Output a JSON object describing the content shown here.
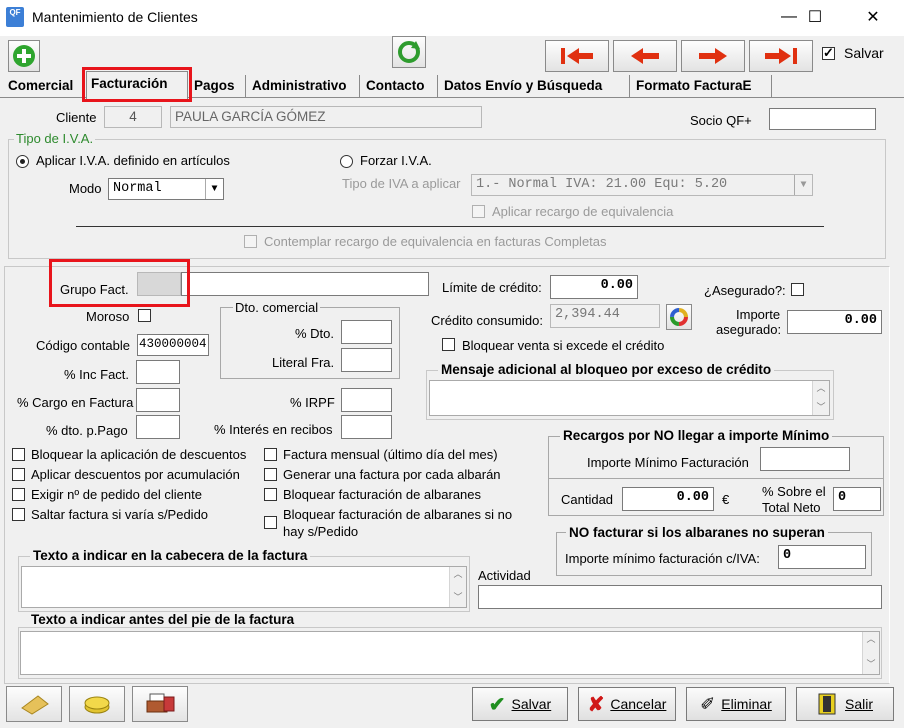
{
  "window": {
    "title": "Mantenimiento de Clientes",
    "app_icon": "QF"
  },
  "toolbar": {
    "save_label": "Salvar"
  },
  "tabs": [
    "Comercial",
    "Facturación",
    "Pagos",
    "Administrativo",
    "Contacto",
    "Datos Envío y Búsqueda",
    "Formato FacturaE"
  ],
  "client": {
    "label": "Cliente",
    "id": "4",
    "name": "PAULA GARCÍA GÓMEZ",
    "socio_label": "Socio QF+",
    "socio_value": ""
  },
  "iva": {
    "group_title": "Tipo de I.V.A.",
    "apply_label": "Aplicar I.V.A. definido en artículos",
    "modo_label": "Modo",
    "modo_value": "Normal",
    "force_label": "Forzar I.V.A.",
    "tipo_label": "Tipo de IVA a aplicar",
    "tipo_value": "1.- Normal  IVA: 21.00  Equ: 5.20",
    "recargo_label": "Aplicar recargo de equivalencia",
    "contemplar_label": "Contemplar recargo de equivalencia en facturas Completas"
  },
  "fact": {
    "grupo_label": "Grupo Fact.",
    "moroso_label": "Moroso",
    "codigo_label": "Código contable",
    "codigo_value": "430000004",
    "inc_label": "% Inc Fact.",
    "cargo_label": "% Cargo en Factura",
    "dto_pago_label": "% dto. p.Pago",
    "dto_group": "Dto. comercial",
    "dto_label": "% Dto.",
    "literal_label": "Literal Fra.",
    "irpf_label": "% IRPF",
    "interes_label": "% Interés en recibos",
    "limite_label": "Límite de crédito:",
    "limite_value": "0.00",
    "consumido_label": "Crédito consumido:",
    "consumido_value": "2,394.44",
    "asegurado_label": "¿Asegurado?:",
    "importe_aseg_label1": "Importe",
    "importe_aseg_label2": "asegurado:",
    "importe_aseg_value": "0.00",
    "bloquear_credito_label": "Bloquear venta si excede el crédito",
    "mensaje_title": "Mensaje adicional al bloqueo por exceso de crédito"
  },
  "checks_left": [
    "Bloquear la aplicación de descuentos",
    "Aplicar descuentos por acumulación",
    "Exigir nº de pedido del cliente",
    "Saltar factura si varía s/Pedido"
  ],
  "checks_mid": [
    "Factura mensual (último día del mes)",
    "Generar una factura por cada albarán",
    "Bloquear facturación de albaranes",
    "Bloquear facturación de albaranes si no",
    "hay s/Pedido"
  ],
  "recargos": {
    "title": "Recargos por NO llegar a importe Mínimo",
    "importe_min_label": "Importe Mínimo Facturación",
    "cantidad_label": "Cantidad",
    "cantidad_value": "0.00",
    "currency": "€",
    "sobre_label1": "% Sobre el",
    "sobre_label2": "Total Neto",
    "sobre_value": "0"
  },
  "nofact": {
    "title": "NO facturar si los albaranes no superan",
    "label": "Importe mínimo facturación c/IVA:",
    "value": "0"
  },
  "texto_cabecera_title": "Texto a indicar en la cabecera de la factura",
  "actividad_label": "Actividad",
  "texto_pie_title": "Texto a indicar antes del pie de la factura",
  "buttons": {
    "salvar": "Salvar",
    "cancelar": "Cancelar",
    "eliminar": "Eliminar",
    "salir": "Salir"
  }
}
